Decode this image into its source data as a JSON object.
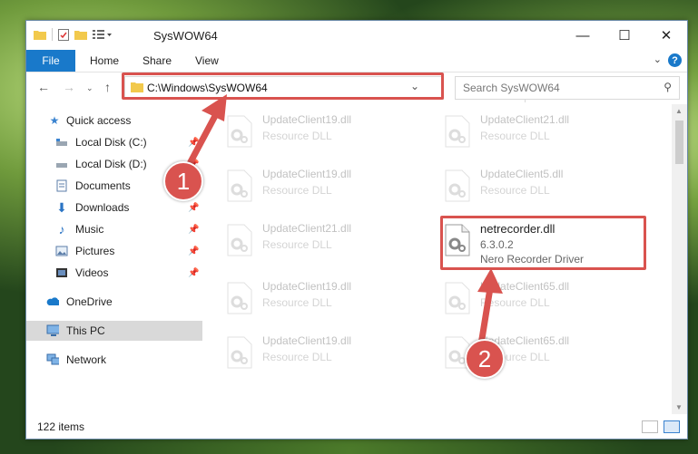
{
  "window": {
    "title": "SysWOW64",
    "controls": {
      "minimize": "—",
      "maximize": "☐",
      "close": "✕"
    }
  },
  "ribbon": {
    "file_label": "File",
    "tabs": [
      "Home",
      "Share",
      "View"
    ],
    "help": "?"
  },
  "address": {
    "path": "C:\\Windows\\SysWOW64",
    "search_placeholder": "Search SysWOW64"
  },
  "sidebar": {
    "items": [
      {
        "label": "Quick access",
        "icon": "star-icon"
      },
      {
        "label": "Local Disk (C:)",
        "icon": "drive-icon",
        "pinned": true
      },
      {
        "label": "Local Disk (D:)",
        "icon": "drive-icon",
        "pinned": true
      },
      {
        "label": "Documents",
        "icon": "documents-icon"
      },
      {
        "label": "Downloads",
        "icon": "downloads-icon",
        "pinned": true
      },
      {
        "label": "Music",
        "icon": "music-icon",
        "pinned": true
      },
      {
        "label": "Pictures",
        "icon": "pictures-icon",
        "pinned": true
      },
      {
        "label": "Videos",
        "icon": "videos-icon",
        "pinned": true
      },
      {
        "label": "OneDrive",
        "icon": "cloud-icon"
      },
      {
        "label": "This PC",
        "icon": "computer-icon",
        "selected": true
      },
      {
        "label": "Network",
        "icon": "network-icon"
      }
    ]
  },
  "files": [
    {
      "name": "UpdateClient19.dll",
      "type": "Resource DLL"
    },
    {
      "name": "UpdateClient21.dll",
      "type": "Resource DLL"
    },
    {
      "name": "UpdateClient19.dll",
      "type": "Resource DLL"
    },
    {
      "name": "UpdateClient5.dll",
      "type": "Resource DLL"
    },
    {
      "name": "UpdateClient21.dll",
      "type": "Resource DLL"
    },
    {
      "name": "netrecorder.dll",
      "version": "6.3.0.2",
      "type": "Nero Recorder Driver",
      "highlighted": true
    },
    {
      "name": "UpdateClient19.dll",
      "type": "Resource DLL"
    },
    {
      "name": "UpdateClient65.dll",
      "type": "Resource DLL"
    },
    {
      "name": "UpdateClient19.dll",
      "type": "Resource DLL"
    },
    {
      "name": "UpdateClient65.dll",
      "type": "Resource DLL"
    }
  ],
  "status": {
    "item_count": "122 items"
  },
  "annotations": {
    "step1": "1",
    "step2": "2"
  },
  "colors": {
    "accent": "#1979ca",
    "annotation": "#d9534f"
  }
}
